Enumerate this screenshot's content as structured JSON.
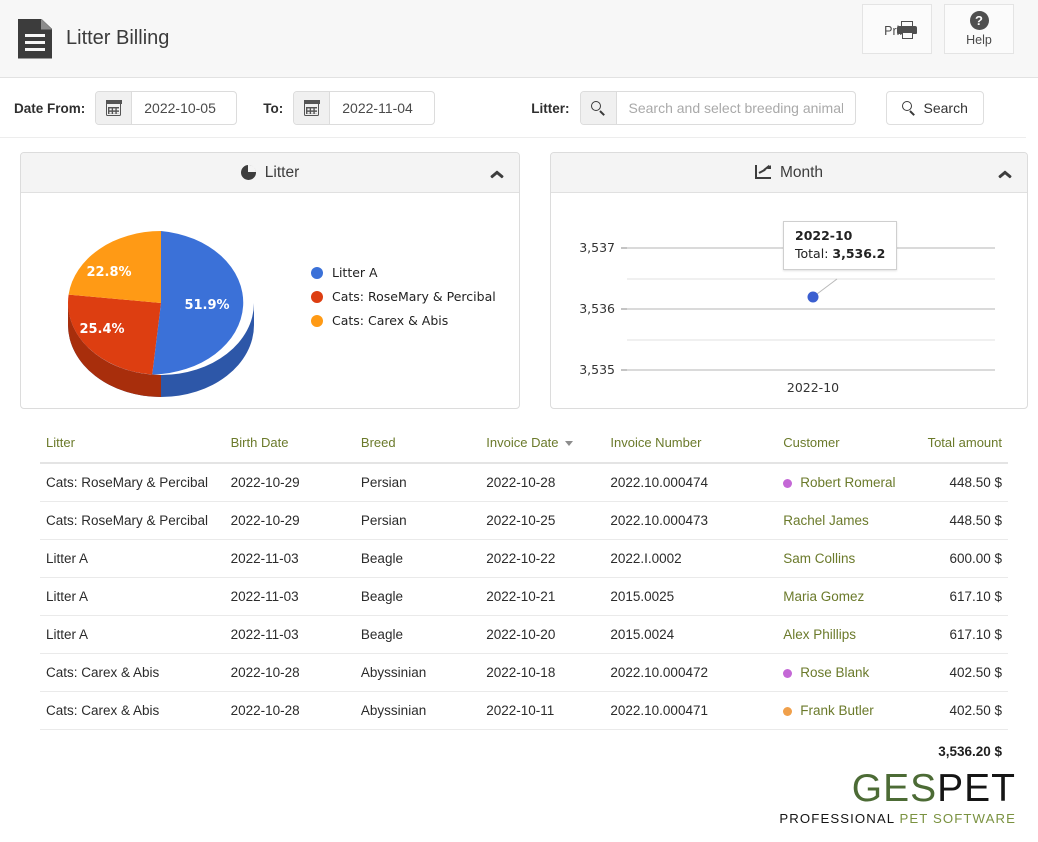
{
  "header": {
    "title": "Litter Billing",
    "doc_icon": "document-icon",
    "actions": [
      {
        "label": "Print",
        "icon": "printer-icon"
      },
      {
        "label": "Help",
        "icon": "question-circle-icon"
      }
    ]
  },
  "toolbar": {
    "date_from_label": "Date From:",
    "date_from_value": "2022-10-05",
    "date_to_label": "To:",
    "date_to_value": "2022-11-04",
    "litter_label": "Litter:",
    "litter_placeholder": "Search and select breeding animal",
    "litter_value": "",
    "search_button": "Search",
    "calendar_icon": "calendar-icon",
    "search_icon": "search-icon"
  },
  "panels": {
    "litter": {
      "title": "Litter",
      "icon": "pie-chart-icon",
      "collapse_icon": "chevron-up-icon"
    },
    "month": {
      "title": "Month",
      "icon": "line-chart-icon",
      "collapse_icon": "chevron-up-icon"
    }
  },
  "chart_data": [
    {
      "type": "pie",
      "title": "Litter",
      "three_d": true,
      "legend": "right",
      "categories": [
        "Litter A",
        "Cats: RoseMary &  Percibal",
        "Cats: Carex & Abis"
      ],
      "values": [
        51.9,
        25.4,
        22.8
      ],
      "value_labels": [
        "51.9%",
        "25.4%",
        "22.8%"
      ],
      "colors": [
        "#3b71d8",
        "#dd3e11",
        "#ff9a15"
      ]
    },
    {
      "type": "line",
      "title": "Month",
      "x": [
        "2022-10"
      ],
      "series": [
        {
          "name": "Total",
          "values": [
            3536.2
          ]
        }
      ],
      "xlabel": "",
      "ylabel": "",
      "ytick_labels": [
        "3,537",
        "3,536",
        "3,535"
      ],
      "ytick_values": [
        3537,
        3536,
        3535
      ],
      "ylim": [
        3534.6,
        3537.4
      ],
      "grid": true,
      "point_color": "#3b5fd0",
      "tooltip": {
        "title": "2022-10",
        "label": "Total:",
        "value": "3,536.2"
      }
    }
  ],
  "table": {
    "columns": [
      {
        "label": "Litter",
        "align": "left"
      },
      {
        "label": "Birth Date",
        "align": "left"
      },
      {
        "label": "Breed",
        "align": "left"
      },
      {
        "label": "Invoice Date",
        "align": "left",
        "sorted": true,
        "sort_icon": "caret-down-icon"
      },
      {
        "label": "Invoice Number",
        "align": "left"
      },
      {
        "label": "Customer",
        "align": "left"
      },
      {
        "label": "Total amount",
        "align": "right"
      }
    ],
    "rows": [
      {
        "litter": "Cats: RoseMary & Percibal",
        "birth_date": "2022-10-29",
        "breed": "Persian",
        "invoice_date": "2022-10-28",
        "invoice_number": "2022.10.000474",
        "customer": "Robert Romeral",
        "dot": "#c468d6",
        "total": "448.50 $"
      },
      {
        "litter": "Cats: RoseMary & Percibal",
        "birth_date": "2022-10-29",
        "breed": "Persian",
        "invoice_date": "2022-10-25",
        "invoice_number": "2022.10.000473",
        "customer": "Rachel James",
        "dot": "",
        "total": "448.50 $"
      },
      {
        "litter": "Litter A",
        "birth_date": "2022-11-03",
        "breed": "Beagle",
        "invoice_date": "2022-10-22",
        "invoice_number": "2022.I.0002",
        "customer": "Sam Collins",
        "dot": "",
        "total": "600.00 $"
      },
      {
        "litter": "Litter A",
        "birth_date": "2022-11-03",
        "breed": "Beagle",
        "invoice_date": "2022-10-21",
        "invoice_number": "2015.0025",
        "customer": "Maria Gomez",
        "dot": "",
        "total": "617.10 $"
      },
      {
        "litter": "Litter A",
        "birth_date": "2022-11-03",
        "breed": "Beagle",
        "invoice_date": "2022-10-20",
        "invoice_number": "2015.0024",
        "customer": "Alex Phillips",
        "dot": "",
        "total": "617.10 $"
      },
      {
        "litter": "Cats: Carex & Abis",
        "birth_date": "2022-10-28",
        "breed": "Abyssinian",
        "invoice_date": "2022-10-18",
        "invoice_number": "2022.10.000472",
        "customer": "Rose Blank",
        "dot": "#c468d6",
        "total": "402.50 $"
      },
      {
        "litter": "Cats: Carex & Abis",
        "birth_date": "2022-10-28",
        "breed": "Abyssinian",
        "invoice_date": "2022-10-11",
        "invoice_number": "2022.10.000471",
        "customer": "Frank Butler",
        "dot": "#f0a04b",
        "total": "402.50 $"
      }
    ],
    "grand_total": "3,536.20 $"
  },
  "logo": {
    "part1": "GES",
    "part2": "PET",
    "sub1": "PROFESSIONAL",
    "sub2": "PET SOFTWARE"
  }
}
